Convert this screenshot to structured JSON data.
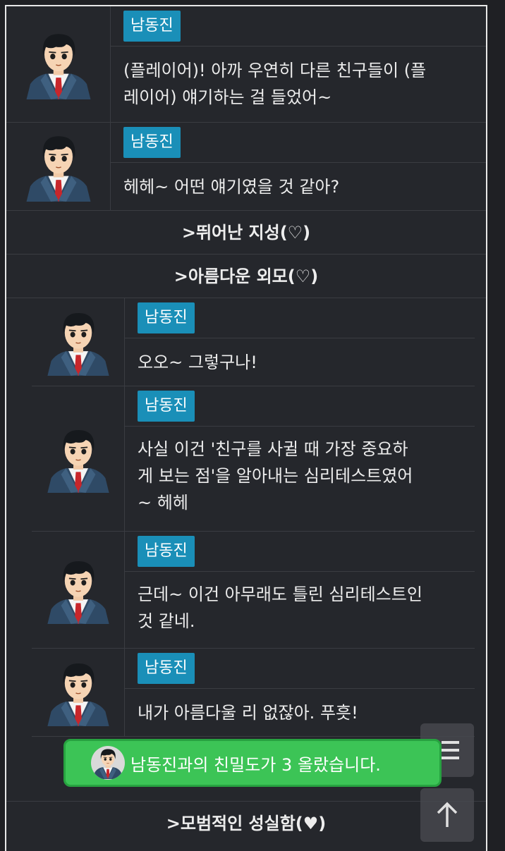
{
  "messages": [
    {
      "speaker": "남동진",
      "lines": [
        "(플레이어)! 아까 우연히 다른 친구들이 (플",
        "레이어) 얘기하는 걸 들었어~"
      ]
    },
    {
      "speaker": "남동진",
      "lines": [
        "헤헤~ 어떤 얘기였을 것 같아?"
      ]
    },
    {
      "speaker": "남동진",
      "lines": [
        "오오~ 그렇구나!"
      ]
    },
    {
      "speaker": "남동진",
      "lines": [
        "사실 이건 '친구를 사귈 때 가장 중요하",
        "게 보는 점'을 알아내는 심리테스트였어",
        "~ 헤헤"
      ]
    },
    {
      "speaker": "남동진",
      "lines": [
        "근데~ 이건 아무래도 틀린 심리테스트인",
        "것 같네."
      ]
    },
    {
      "speaker": "남동진",
      "lines": [
        "내가 아름다울 리 없잖아. 푸흣!"
      ]
    }
  ],
  "choices": [
    {
      "label": ">뛰어난 지성(♡)"
    },
    {
      "label": ">아름다운 외모(♡)"
    },
    {
      "label": ">모범적인 성실함(♥)"
    }
  ],
  "toast": {
    "text": "남동진과의 친밀도가 3 올랐습니다."
  },
  "icons": {
    "menu": "menu-icon",
    "scroll_top": "arrow-up-icon",
    "avatar": "student-avatar-icon"
  },
  "colors": {
    "name_tag": "#1a8fb8",
    "toast_bg": "#3cc456",
    "background": "#25272c"
  }
}
